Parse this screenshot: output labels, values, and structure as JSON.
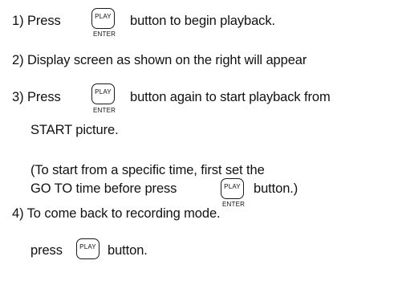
{
  "steps": {
    "s1": {
      "before": "1) Press",
      "after": "button to begin playback."
    },
    "s2": {
      "text": "2) Display screen as shown on the right will appear"
    },
    "s3": {
      "before": "3) Press",
      "after": "button again to start playback from",
      "cont": "START picture."
    },
    "note": {
      "l1": "(To start from a specific time, first set the",
      "l2_before": "GO TO time before press",
      "l2_after": "button.)"
    },
    "s4": {
      "text": "4) To come back to recording mode.",
      "press": "press",
      "after": "button."
    }
  },
  "key": {
    "cap": "PLAY",
    "sub": "ENTER"
  }
}
